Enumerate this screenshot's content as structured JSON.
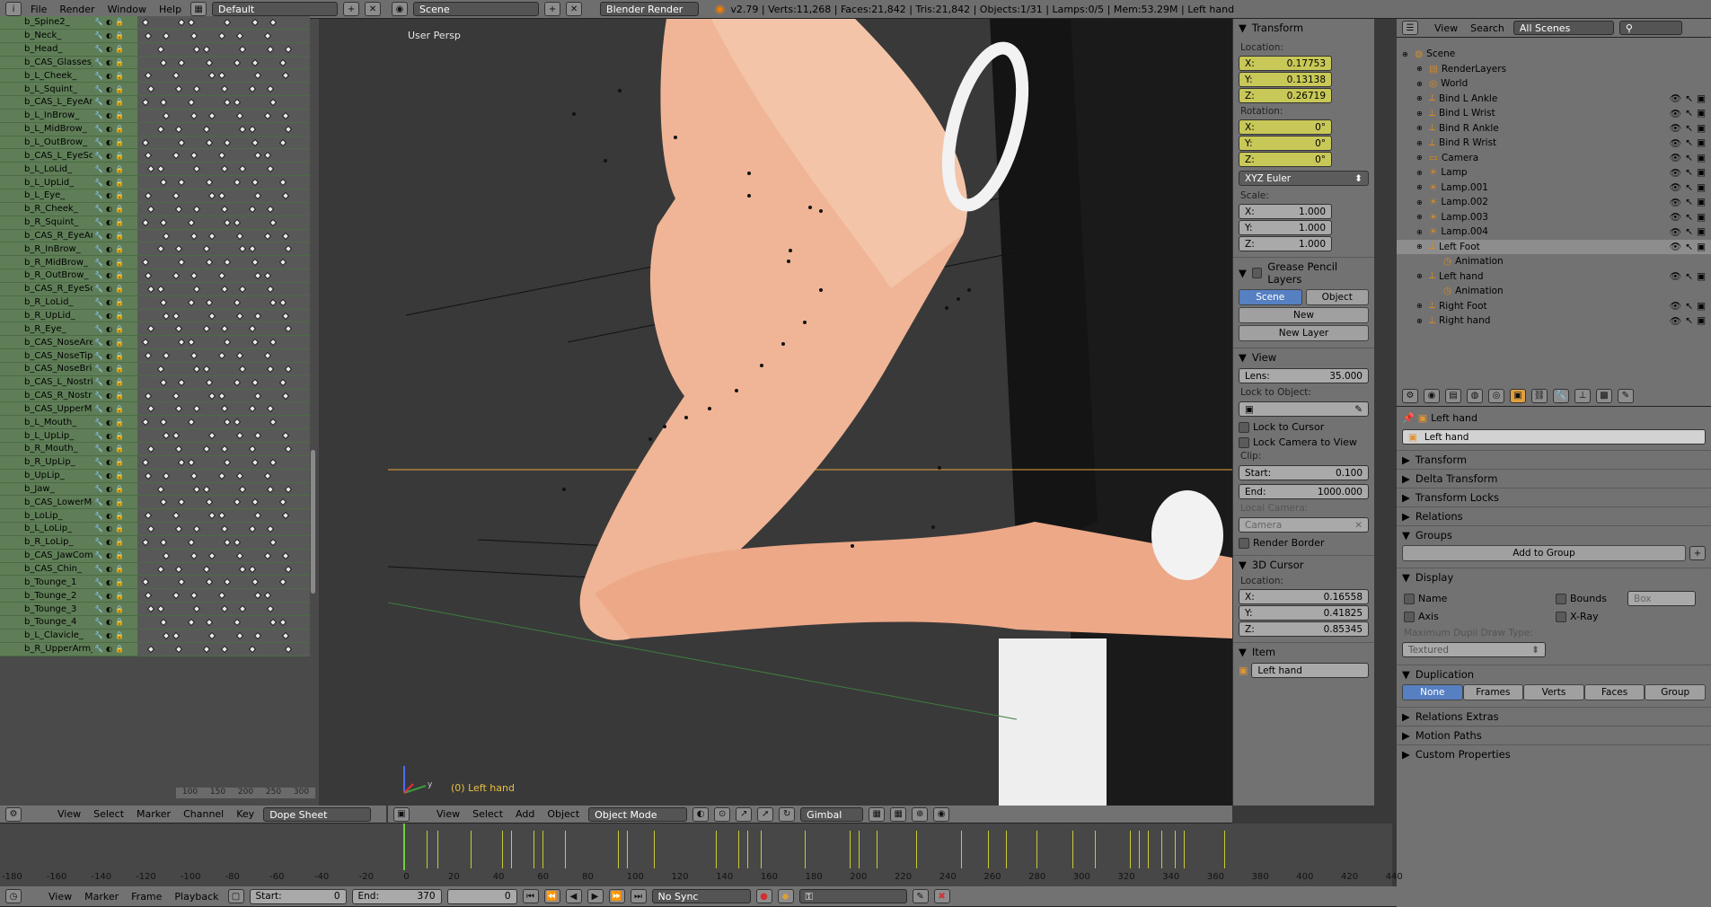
{
  "topbar": {
    "menus": [
      "File",
      "Render",
      "Window",
      "Help"
    ],
    "layout": "Default",
    "scene": "Scene",
    "engine": "Blender Render",
    "stats": "v2.79 | Verts:11,268 | Faces:21,842 | Tris:21,842 | Objects:1/31 | Lamps:0/5 | Mem:53.29M | Left hand"
  },
  "dopesheet": {
    "channels": [
      "b_Spine2_",
      "b_Neck_",
      "b_Head_",
      "b_CAS_Glasses_",
      "b_L_Cheek_",
      "b_L_Squint_",
      "b_CAS_L_EyeArea_",
      "b_L_InBrow_",
      "b_L_MidBrow_",
      "b_L_OutBrow_",
      "b_CAS_L_EyeScale_",
      "b_L_LoLid_",
      "b_L_UpLid_",
      "b_L_Eye_",
      "b_R_Cheek_",
      "b_R_Squint_",
      "b_CAS_R_EyeArea_",
      "b_R_InBrow_",
      "b_R_MidBrow_",
      "b_R_OutBrow_",
      "b_CAS_R_EyeScale_",
      "b_R_LoLid_",
      "b_R_UpLid_",
      "b_R_Eye_",
      "b_CAS_NoseArea_",
      "b_CAS_NoseTip_",
      "b_CAS_NoseBridge_",
      "b_CAS_L_Nostril_",
      "b_CAS_R_Nostril_",
      "b_CAS_UpperMouthArea_",
      "b_L_Mouth_",
      "b_L_UpLip_",
      "b_R_Mouth_",
      "b_R_UpLip_",
      "b_UpLip_",
      "b_Jaw_",
      "b_CAS_LowerMouthArea_",
      "b_LoLip_",
      "b_L_LoLip_",
      "b_R_LoLip_",
      "b_CAS_JawComp_",
      "b_CAS_Chin_",
      "b_Tounge_1",
      "b_Tounge_2",
      "b_Tounge_3",
      "b_Tounge_4",
      "b_L_Clavicle_",
      "b_R_UpperArm_"
    ],
    "ruler": [
      "100",
      "150",
      "200",
      "250",
      "300"
    ],
    "header": {
      "menus": [
        "View",
        "Select",
        "Marker",
        "Channel",
        "Key"
      ],
      "mode": "Dope Sheet"
    }
  },
  "viewport": {
    "label": "User Persp",
    "object_label": "(0) Left hand",
    "axis_y": "y",
    "header": {
      "menus": [
        "View",
        "Select",
        "Add",
        "Object"
      ],
      "mode": "Object Mode",
      "orientation": "Gimbal"
    }
  },
  "npanel": {
    "transform": {
      "title": "Transform",
      "location_label": "Location:",
      "location": {
        "x": "0.17753",
        "y": "0.13138",
        "z": "0.26719"
      },
      "rotation_label": "Rotation:",
      "rotation": {
        "x": "0°",
        "y": "0°",
        "z": "0°"
      },
      "rotation_mode": "XYZ Euler",
      "scale_label": "Scale:",
      "scale": {
        "x": "1.000",
        "y": "1.000",
        "z": "1.000"
      }
    },
    "grease": {
      "title": "Grease Pencil Layers",
      "scene": "Scene",
      "object": "Object",
      "new": "New",
      "new_layer": "New Layer"
    },
    "view": {
      "title": "View",
      "lens_label": "Lens:",
      "lens": "35.000",
      "lock_label": "Lock to Object:",
      "lock_cursor": "Lock to Cursor",
      "lock_camera": "Lock Camera to View",
      "clip_label": "Clip:",
      "start_label": "Start:",
      "start": "0.100",
      "end_label": "End:",
      "end": "1000.000",
      "local_camera_label": "Local Camera:",
      "camera": "Camera",
      "render_border": "Render Border"
    },
    "cursor": {
      "title": "3D Cursor",
      "location_label": "Location:",
      "x": "0.16558",
      "y": "0.41825",
      "z": "0.85345"
    },
    "item": {
      "title": "Item",
      "name": "Left hand"
    }
  },
  "outliner": {
    "menus": [
      "View",
      "Search"
    ],
    "filter": "All Scenes",
    "items": [
      {
        "name": "Scene",
        "indent": 0,
        "icon": "scene"
      },
      {
        "name": "RenderLayers",
        "indent": 1,
        "icon": "renderlayers"
      },
      {
        "name": "World",
        "indent": 1,
        "icon": "world"
      },
      {
        "name": "Bind L Ankle",
        "indent": 1,
        "icon": "armature"
      },
      {
        "name": "Bind L Wrist",
        "indent": 1,
        "icon": "armature"
      },
      {
        "name": "Bind R Ankle",
        "indent": 1,
        "icon": "armature"
      },
      {
        "name": "Bind R Wrist",
        "indent": 1,
        "icon": "armature"
      },
      {
        "name": "Camera",
        "indent": 1,
        "icon": "camera"
      },
      {
        "name": "Lamp",
        "indent": 1,
        "icon": "lamp"
      },
      {
        "name": "Lamp.001",
        "indent": 1,
        "icon": "lamp"
      },
      {
        "name": "Lamp.002",
        "indent": 1,
        "icon": "lamp"
      },
      {
        "name": "Lamp.003",
        "indent": 1,
        "icon": "lamp"
      },
      {
        "name": "Lamp.004",
        "indent": 1,
        "icon": "lamp"
      },
      {
        "name": "Left Foot",
        "indent": 1,
        "icon": "armature"
      },
      {
        "name": "Animation",
        "indent": 2,
        "icon": "animation"
      },
      {
        "name": "Left hand",
        "indent": 1,
        "icon": "armature"
      },
      {
        "name": "Animation",
        "indent": 2,
        "icon": "animation"
      },
      {
        "name": "Right Foot",
        "indent": 1,
        "icon": "armature"
      },
      {
        "name": "Right hand",
        "indent": 1,
        "icon": "armature"
      }
    ]
  },
  "properties": {
    "breadcrumb": "Left hand",
    "name": "Left hand",
    "panels": [
      "Transform",
      "Delta Transform",
      "Transform Locks",
      "Relations"
    ],
    "groups": {
      "title": "Groups",
      "add": "Add to Group"
    },
    "display": {
      "title": "Display",
      "name": "Name",
      "axis": "Axis",
      "bounds": "Bounds",
      "bounds_type": "Box",
      "xray": "X-Ray",
      "max_draw_label": "Maximum Dupli Draw Type:",
      "max_draw": "Textured"
    },
    "duplication": {
      "title": "Duplication",
      "options": [
        "None",
        "Frames",
        "Verts",
        "Faces",
        "Group"
      ]
    },
    "more": [
      "Relations Extras",
      "Motion Paths",
      "Custom Properties"
    ]
  },
  "timeline": {
    "ruler": [
      "-180",
      "-160",
      "-140",
      "-120",
      "-100",
      "-80",
      "-60",
      "-40",
      "-20",
      "0",
      "20",
      "40",
      "60",
      "80",
      "100",
      "120",
      "140",
      "160",
      "180",
      "200",
      "220",
      "240",
      "260",
      "280",
      "300",
      "320",
      "340",
      "360",
      "380",
      "400",
      "420",
      "440"
    ],
    "menus": [
      "View",
      "Marker",
      "Frame",
      "Playback"
    ],
    "start_label": "Start:",
    "start": "0",
    "end_label": "End:",
    "end": "370",
    "current": "0",
    "sync": "No Sync"
  },
  "colors": {
    "accent": "#5680c2",
    "keyframe_marker": "#c9c938",
    "current_frame": "#6fd03a",
    "skin": "#f0b596"
  }
}
